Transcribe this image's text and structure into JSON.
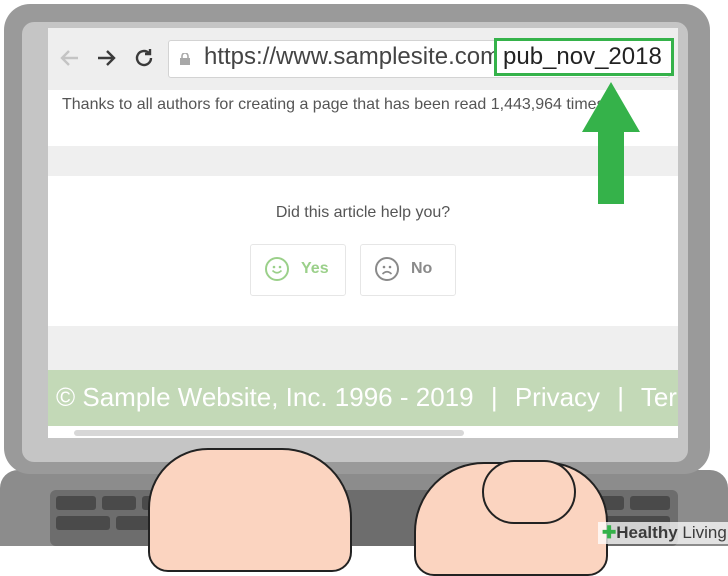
{
  "browser": {
    "url_base": "https://www.samplesite.com/",
    "url_path": "pub_nov_2018",
    "back_icon": "back-arrow-icon",
    "forward_icon": "forward-arrow-icon",
    "reload_icon": "reload-icon",
    "lock_icon": "lock-icon"
  },
  "page": {
    "thanks_text": "Thanks to all authors for creating a page that has been read 1,443,964 times.",
    "help_question": "Did this article help you?",
    "yes_label": "Yes",
    "no_label": "No",
    "footer_copyright": "© Sample Website, Inc. 1996 - 2019",
    "footer_sep1": "|",
    "footer_privacy": "Privacy",
    "footer_sep2": "|",
    "footer_terms": "Terms"
  },
  "watermark": {
    "brand": "Healthy",
    "brand_suffix": "Living"
  },
  "colors": {
    "accent_green": "#35b24a",
    "footer_green": "#c3d9b7",
    "yes_green": "#9bd08a",
    "no_gray": "#8a8a8a"
  }
}
